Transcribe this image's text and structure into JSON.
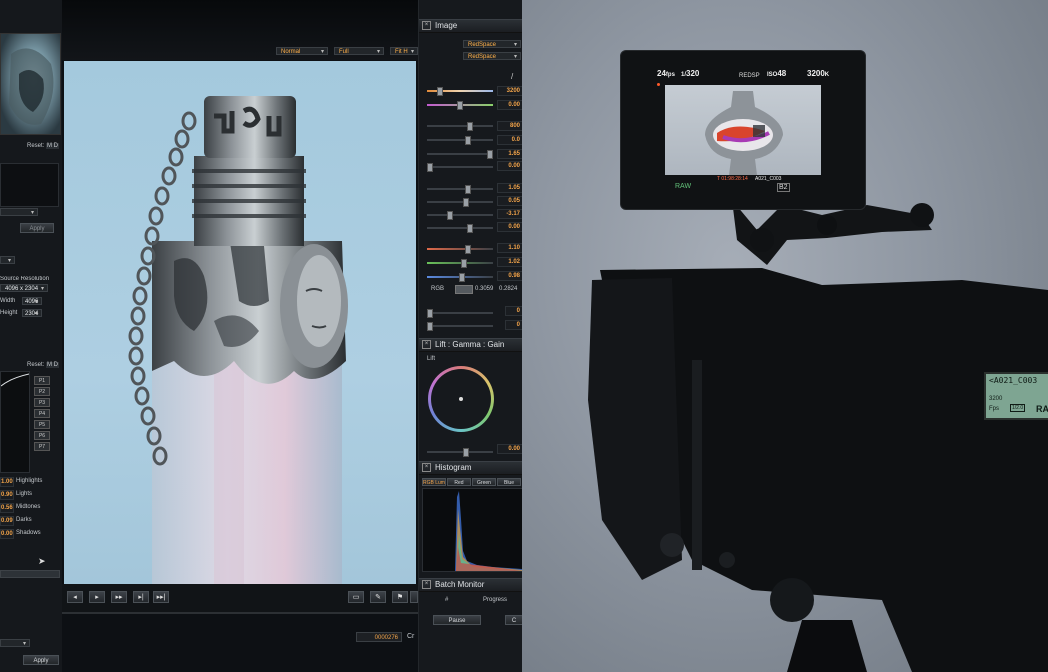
{
  "viewer": {
    "mode_normal": "Normal",
    "mode_full": "Full",
    "mode_fit": "Fit H",
    "timecode": "0000276",
    "timecode_suffix": "Cr"
  },
  "left_panel": {
    "reset1": "Reset:",
    "reset1_btns": "M D",
    "apply_top": "Apply",
    "source_resolution": "Source Resolution",
    "resolution_value": "4096 x 2304",
    "width_label": "Width",
    "width_value": "4096",
    "height_label": "Height",
    "height_value": "2304",
    "reset2": "Reset:",
    "reset2_btns": "M D",
    "presets": [
      "P1",
      "P2",
      "P3",
      "P4",
      "P5",
      "P6",
      "P7"
    ],
    "tone": [
      {
        "value": "1.00",
        "label": "Highlights"
      },
      {
        "value": "0.90",
        "label": "Lights"
      },
      {
        "value": "0.56",
        "label": "Midtones"
      },
      {
        "value": "0.09",
        "label": "Darks"
      },
      {
        "value": "0.00",
        "label": "Shadows"
      }
    ],
    "apply_bottom": "Apply"
  },
  "image_panel": {
    "title": "Image",
    "color_space_1": "RedSpace",
    "color_space_2": "RedSpace",
    "values": [
      "3200",
      "0.00",
      "800",
      "0.0",
      "1.65",
      "0.00",
      "1.05",
      "0.05",
      "-3.17",
      "0.00",
      "1.10",
      "1.02",
      "0.98"
    ],
    "rgb_label": "RGB",
    "rgb_val1": "0.3059",
    "rgb_val2": "0.2824",
    "extra_values": [
      "0",
      "0"
    ]
  },
  "lgg_panel": {
    "title": "Lift : Gamma : Gain",
    "wheel_label": "Lift",
    "wheel_value": "0.00"
  },
  "histogram_panel": {
    "title": "Histogram",
    "tabs": [
      "RGB Lum",
      "Red",
      "Green",
      "Blue"
    ]
  },
  "batch_panel": {
    "title": "Batch Monitor",
    "col_num": "#",
    "col_progress": "Progress",
    "pause": "Pause",
    "extra_btn": "C"
  },
  "monitor": {
    "fps": "24",
    "fps_unit": "fps",
    "shutter": "320",
    "shutter_prefix": "1/",
    "iso": "48",
    "iso_prefix": "ISO",
    "rsp": "REDSP",
    "kelvin": "3200",
    "kelvin_unit": "K",
    "raw": "RAW",
    "clip_name": "A021_C003",
    "timecode": "T 01:98:28:14",
    "tag": "B2"
  },
  "camera_lcd": {
    "clip": "<A021_C003",
    "row2": "3200",
    "row3": "Fps",
    "raw": "RA",
    "box": "1/2.0"
  },
  "colors": {
    "accent_orange": "#f1a34a",
    "backdrop": "#9ba3ae",
    "viewer_sky": "#a6cbe0"
  }
}
